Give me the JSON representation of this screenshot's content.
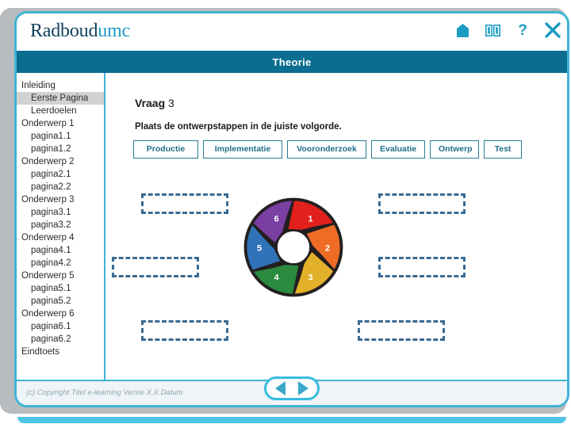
{
  "brand": {
    "name_dark": "Radboud",
    "name_light": "umc"
  },
  "header_icons": [
    {
      "name": "home-icon",
      "label": "Home"
    },
    {
      "name": "book-icon",
      "label": "Begrippenlijst"
    },
    {
      "name": "help-icon",
      "label": "?"
    },
    {
      "name": "close-icon",
      "label": "Sluiten"
    }
  ],
  "title_bar": {
    "label": "Theorie"
  },
  "sidebar": {
    "items": [
      {
        "label": "Inleiding",
        "level": 1,
        "selected": false
      },
      {
        "label": "Eerste Pagina",
        "level": 2,
        "selected": true
      },
      {
        "label": "Leerdoelen",
        "level": 2,
        "selected": false
      },
      {
        "label": "Onderwerp 1",
        "level": 1,
        "selected": false
      },
      {
        "label": "pagina1.1",
        "level": 2,
        "selected": false
      },
      {
        "label": "pagina1.2",
        "level": 2,
        "selected": false
      },
      {
        "label": "Onderwerp 2",
        "level": 1,
        "selected": false
      },
      {
        "label": "pagina2.1",
        "level": 2,
        "selected": false
      },
      {
        "label": "pagina2.2",
        "level": 2,
        "selected": false
      },
      {
        "label": "Onderwerp 3",
        "level": 1,
        "selected": false
      },
      {
        "label": "pagina3.1",
        "level": 2,
        "selected": false
      },
      {
        "label": "pagina3.2",
        "level": 2,
        "selected": false
      },
      {
        "label": "Onderwerp 4",
        "level": 1,
        "selected": false
      },
      {
        "label": "pagina4.1",
        "level": 2,
        "selected": false
      },
      {
        "label": "pagina4.2",
        "level": 2,
        "selected": false
      },
      {
        "label": "Onderwerp 5",
        "level": 1,
        "selected": false
      },
      {
        "label": "pagina5.1",
        "level": 2,
        "selected": false
      },
      {
        "label": "pagina5.2",
        "level": 2,
        "selected": false
      },
      {
        "label": "Onderwerp 6",
        "level": 1,
        "selected": false
      },
      {
        "label": "pagina6.1",
        "level": 2,
        "selected": false
      },
      {
        "label": "pagina6.2",
        "level": 2,
        "selected": false
      },
      {
        "label": "Eindtoets",
        "level": 1,
        "selected": false
      }
    ]
  },
  "question": {
    "label": "Vraag",
    "number": "3",
    "prompt": "Plaats de ontwerpstappen in de juiste volgorde."
  },
  "answer_chips": [
    {
      "label": "Productie"
    },
    {
      "label": "Implementatie"
    },
    {
      "label": "Vooronderzoek"
    },
    {
      "label": "Evaluatie"
    },
    {
      "label": "Ontwerp"
    },
    {
      "label": "Test"
    }
  ],
  "drop_zones": [
    {
      "slot": "1",
      "value": ""
    },
    {
      "slot": "2",
      "value": ""
    },
    {
      "slot": "3",
      "value": ""
    },
    {
      "slot": "4",
      "value": ""
    },
    {
      "slot": "5",
      "value": ""
    },
    {
      "slot": "6",
      "value": ""
    }
  ],
  "wheel": {
    "segments": [
      {
        "number": "1",
        "color": "#e2211c"
      },
      {
        "number": "2",
        "color": "#ef6c24"
      },
      {
        "number": "3",
        "color": "#e3b02a"
      },
      {
        "number": "4",
        "color": "#2a8a3e"
      },
      {
        "number": "5",
        "color": "#2f72b8"
      },
      {
        "number": "6",
        "color": "#7b3fa3"
      }
    ],
    "hub_color": "#ffffff",
    "outline_color": "#231f20"
  },
  "footer": {
    "copyright": "(c) Copyright Titel e-learning Versie X.X Datum",
    "prev_label": "Vorige",
    "next_label": "Volgende"
  },
  "colors": {
    "brand_teal": "#0b6d90",
    "brand_cyan": "#3fb3d4",
    "dashed_blue": "#3a6a92",
    "chip_text": "#1f6f88"
  }
}
